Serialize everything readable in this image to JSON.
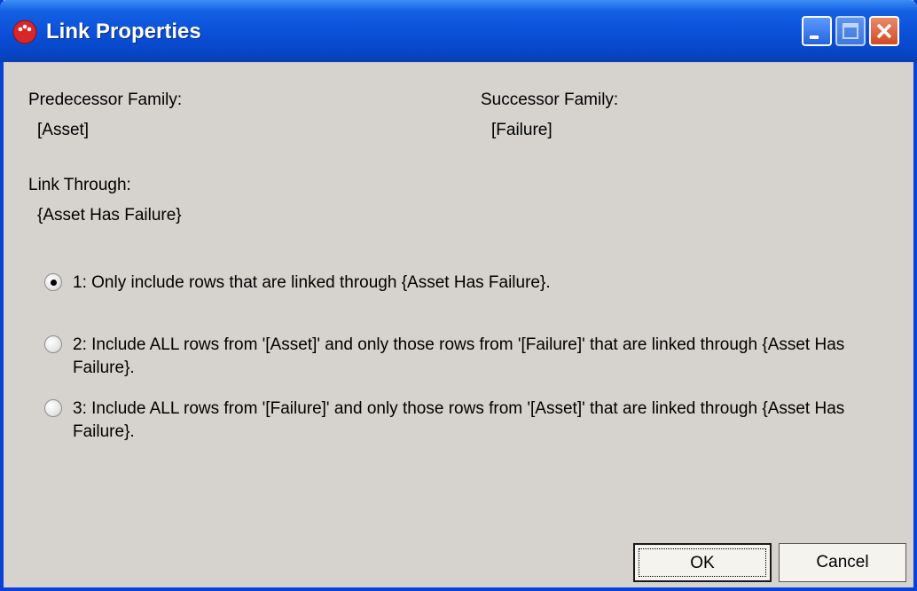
{
  "window": {
    "title": "Link Properties"
  },
  "predecessor": {
    "label": "Predecessor Family:",
    "value": "[Asset]"
  },
  "successor": {
    "label": "Successor Family:",
    "value": "[Failure]"
  },
  "link_through": {
    "label": "Link Through:",
    "value": "{Asset Has Failure}"
  },
  "options": [
    {
      "text": "1:  Only include rows that are linked through {Asset Has Failure}.",
      "selected": true
    },
    {
      "text": "2:  Include ALL rows from '[Asset]' and only those rows from '[Failure]' that are linked through {Asset Has Failure}.",
      "selected": false
    },
    {
      "text": "3:  Include ALL rows from '[Failure]' and only those rows from '[Asset]' that are linked through {Asset Has Failure}.",
      "selected": false
    }
  ],
  "buttons": {
    "ok": "OK",
    "cancel": "Cancel"
  },
  "icons": {
    "app": "red-dots-icon",
    "minimize": "minimize-icon",
    "maximize": "maximize-icon",
    "close": "close-icon"
  },
  "colors": {
    "titlebar": "#0a4fd8",
    "window_bg": "#d6d3ce",
    "close_button": "#d24b25"
  }
}
